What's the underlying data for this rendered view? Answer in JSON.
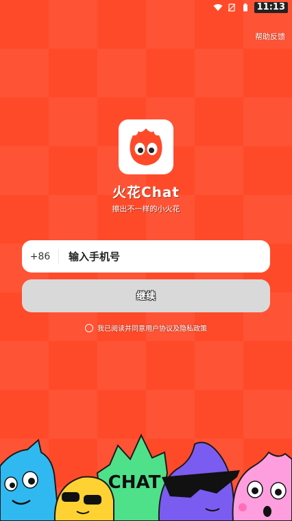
{
  "status_bar": {
    "time": "11:13",
    "icons": [
      "wifi-icon",
      "no-sim-icon",
      "battery-icon"
    ]
  },
  "header": {
    "help_label": "帮助反馈"
  },
  "brand": {
    "app_name": "火花Chat",
    "slogan": "擦出不一样的小火花",
    "logo_icon": "flame-mascot-icon"
  },
  "login": {
    "country_code": "+86",
    "phone_placeholder": "输入手机号",
    "continue_label": "继续",
    "agreement_text": "我已阅读并同意用户协议及隐私政策"
  },
  "mascots": {
    "chat_label": "CHAT",
    "characters": [
      "blue-mascot",
      "yellow-mascot",
      "green-mascot",
      "purple-mascot",
      "pink-mascot"
    ]
  },
  "colors": {
    "background": "#ff4a2a",
    "button_disabled": "#d9d9d9",
    "logo_flame": "#ff4a2a"
  }
}
